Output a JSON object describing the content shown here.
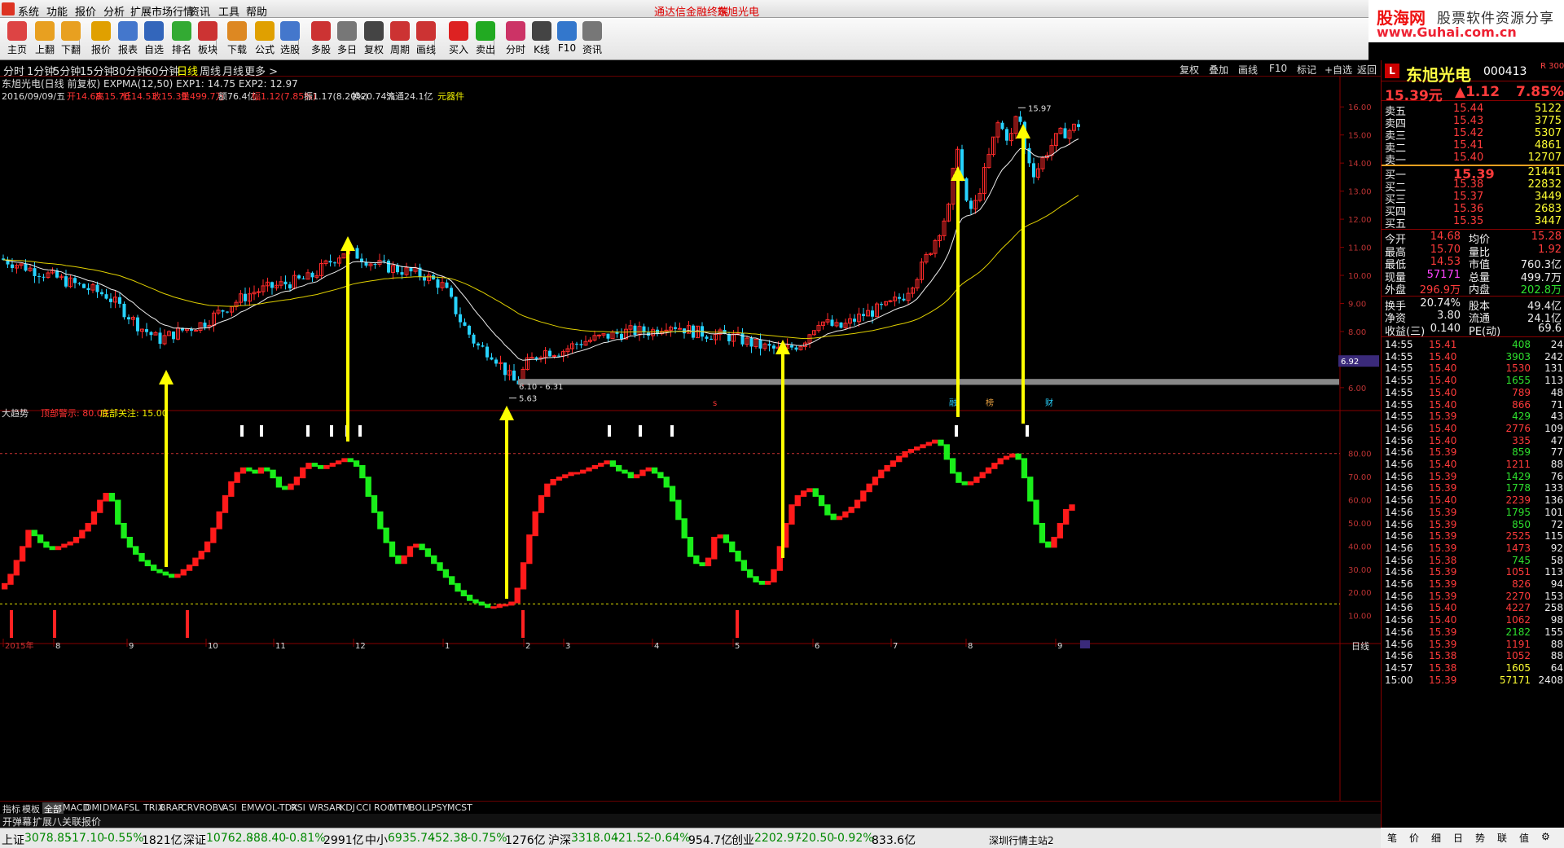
{
  "menubar": {
    "items": [
      "系统",
      "功能",
      "报价",
      "分析",
      "扩展市场行情",
      "资讯",
      "工具",
      "帮助"
    ],
    "center_title": "通达信金融终端",
    "center_stock": "东旭光电"
  },
  "brand": {
    "line1": "股海网",
    "line2": "股票软件资源分享",
    "line3": "www.Guhai.com.cn"
  },
  "toolbar": {
    "buttons": [
      {
        "label": "主页",
        "icon": "home-icon",
        "color": "#d44"
      },
      {
        "label": "上翻",
        "icon": "up-arrow-icon",
        "color": "#e8a020"
      },
      {
        "label": "下翻",
        "icon": "down-arrow-icon",
        "color": "#e8a020"
      },
      {
        "label": "报价",
        "icon": "yen-icon",
        "color": "#e0a000"
      },
      {
        "label": "报表",
        "icon": "report-icon",
        "color": "#4477cc"
      },
      {
        "label": "自选",
        "icon": "f6-icon",
        "color": "#3366bb"
      },
      {
        "label": "排名",
        "icon": "rank-icon",
        "color": "#33aa33"
      },
      {
        "label": "板块",
        "icon": "blocks-icon",
        "color": "#cc3333"
      },
      {
        "label": "下载",
        "icon": "download-icon",
        "color": "#dd8822"
      },
      {
        "label": "公式",
        "icon": "formula-icon",
        "color": "#e0a000"
      },
      {
        "label": "选股",
        "icon": "select-icon",
        "color": "#4477cc"
      },
      {
        "label": "多股",
        "icon": "multi-icon",
        "color": "#cc3333"
      },
      {
        "label": "多日",
        "icon": "clock-icon",
        "color": "#777777"
      },
      {
        "label": "复权",
        "icon": "restore-icon",
        "color": "#444444"
      },
      {
        "label": "周期",
        "icon": "f8-icon",
        "color": "#cc3333"
      },
      {
        "label": "画线",
        "icon": "draw-icon",
        "color": "#cc3333"
      },
      {
        "label": "买入",
        "icon": "buy-icon",
        "color": "#dd2222"
      },
      {
        "label": "卖出",
        "icon": "sell-icon",
        "color": "#22aa22"
      },
      {
        "label": "分时",
        "icon": "timeshare-icon",
        "color": "#cc3366"
      },
      {
        "label": "K线",
        "icon": "kline-icon",
        "color": "#444444"
      },
      {
        "label": "F10",
        "icon": "f10-icon",
        "color": "#3377cc"
      },
      {
        "label": "资讯",
        "icon": "news-icon",
        "color": "#777777"
      }
    ]
  },
  "period_bar": {
    "items": [
      "分时",
      "1分钟",
      "5分钟",
      "15分钟",
      "30分钟",
      "60分钟",
      "日线",
      "周线",
      "月线",
      "更多 >"
    ],
    "active": "日线",
    "right_items": [
      "复权",
      "叠加",
      "画线",
      "F10",
      "标记",
      "+自选",
      "返回"
    ]
  },
  "chart_header": {
    "title": "东旭光电(日线 前复权) EXPMA(12,50) EXP1: 14.75 EXP2: 12.97",
    "date_info": "2016/09/09/五",
    "open": "开14.68",
    "high": "高15.70",
    "low": "低14.53",
    "close": "收15.39",
    "volume": "量499.7万",
    "amount": "额76.4亿",
    "change": "幅1.12(7.85%)",
    "amplitude": "振1.17(8.20%)",
    "turnover": "换20.74%",
    "float": "流通24.1亿",
    "sector": "元器件"
  },
  "indicator_header": {
    "name": "大趋势",
    "top_warning": "顶部警示: 80.00",
    "bottom_attention": "底部关注: 15.00"
  },
  "chart_data": [
    {
      "type": "candlestick",
      "title": "东旭光电(日线 前复权)",
      "y_ticks": [
        "16.00",
        "15.00",
        "14.00",
        "13.00",
        "12.00",
        "11.00",
        "10.00",
        "9.00",
        "8.00",
        "7.00",
        "6.00"
      ],
      "ylim": [
        5.3,
        16.5
      ],
      "x_month_labels": [
        "2015年",
        "8",
        "9",
        "10",
        "11",
        "12",
        "1",
        "2",
        "3",
        "4",
        "5",
        "6",
        "7",
        "8",
        "9"
      ],
      "annotations": [
        "15.97",
        "6.10 - 6.31",
        "5.63",
        "6.92"
      ],
      "support_band": {
        "low": 6.1,
        "high": 6.31
      },
      "event_markers": [
        "融",
        "榜",
        "财"
      ],
      "series": [
        {
          "name": "EXP1",
          "value": 14.75
        },
        {
          "name": "EXP2",
          "value": 12.97
        }
      ]
    },
    {
      "type": "line",
      "title": "大趋势",
      "y_ticks": [
        "80.00",
        "70.00",
        "60.00",
        "50.00",
        "40.00",
        "30.00",
        "20.00",
        "10.00"
      ],
      "ylim": [
        0,
        88
      ],
      "top_line": 80,
      "bottom_line": 15,
      "values": [
        22,
        24,
        28,
        34,
        40,
        47,
        45,
        42,
        40,
        39,
        40,
        41,
        42,
        44,
        47,
        50,
        55,
        60,
        63,
        60,
        50,
        44,
        40,
        37,
        34,
        32,
        30,
        29,
        28,
        27,
        28,
        30,
        32,
        35,
        38,
        42,
        48,
        55,
        62,
        68,
        72,
        74,
        73,
        72,
        74,
        73,
        70,
        66,
        65,
        67,
        70,
        74,
        76,
        75,
        74,
        75,
        76,
        77,
        78,
        77,
        75,
        70,
        62,
        55,
        48,
        42,
        36,
        33,
        36,
        40,
        41,
        39,
        36,
        33,
        30,
        27,
        24,
        21,
        19,
        17,
        16,
        15,
        14,
        14,
        15,
        15,
        16,
        22,
        33,
        45,
        55,
        62,
        67,
        69,
        70,
        71,
        72,
        72,
        73,
        74,
        75,
        76,
        77,
        75,
        73,
        72,
        70,
        71,
        73,
        74,
        72,
        70,
        66,
        60,
        52,
        44,
        36,
        33,
        32,
        35,
        44,
        45,
        42,
        38,
        34,
        30,
        27,
        25,
        24,
        25,
        30,
        40,
        50,
        58,
        62,
        64,
        65,
        62,
        58,
        54,
        52,
        53,
        55,
        57,
        60,
        64,
        67,
        70,
        73,
        75,
        77,
        79,
        81,
        82,
        83,
        84,
        85,
        86,
        84,
        78,
        72,
        68,
        67,
        68,
        70,
        72,
        74,
        76,
        78,
        79,
        80,
        78,
        70,
        60,
        50,
        42,
        40,
        44,
        50,
        56,
        58
      ],
      "bottom_signal_bars": [
        "2015-08 early",
        "2015-08",
        "2015-09",
        "2016-01-end",
        "2016-05"
      ],
      "top_signal_marks": 14
    }
  ],
  "right_panel": {
    "badge": "L",
    "name": "东旭光电",
    "code": "000413",
    "r_mark": "R 300",
    "price": "15.39元",
    "change": "▲1.12",
    "pct": "7.85%",
    "asks": [
      {
        "label": "卖五",
        "price": "15.44",
        "vol": "5122"
      },
      {
        "label": "卖四",
        "price": "15.43",
        "vol": "3775"
      },
      {
        "label": "卖三",
        "price": "15.42",
        "vol": "5307"
      },
      {
        "label": "卖二",
        "price": "15.41",
        "vol": "4861"
      },
      {
        "label": "卖一",
        "price": "15.40",
        "vol": "12707"
      }
    ],
    "bids": [
      {
        "label": "买一",
        "price": "15.39",
        "vol": "21441"
      },
      {
        "label": "买二",
        "price": "15.38",
        "vol": "22832"
      },
      {
        "label": "买三",
        "price": "15.37",
        "vol": "3449"
      },
      {
        "label": "买四",
        "price": "15.36",
        "vol": "2683"
      },
      {
        "label": "买五",
        "price": "15.35",
        "vol": "3447"
      }
    ],
    "stats": [
      {
        "l1": "今开",
        "v1": "14.68",
        "c1": "red",
        "l2": "均价",
        "v2": "15.28",
        "c2": "red"
      },
      {
        "l1": "最高",
        "v1": "15.70",
        "c1": "red",
        "l2": "量比",
        "v2": "1.92",
        "c2": "red"
      },
      {
        "l1": "最低",
        "v1": "14.53",
        "c1": "red",
        "l2": "市值",
        "v2": "760.3亿",
        "c2": "white"
      },
      {
        "l1": "现量",
        "v1": "57171",
        "c1": "magenta",
        "l2": "总量",
        "v2": "499.7万",
        "c2": "white"
      },
      {
        "l1": "外盘",
        "v1": "296.9万",
        "c1": "red",
        "l2": "内盘",
        "v2": "202.8万",
        "c2": "green"
      }
    ],
    "stats2": [
      {
        "l1": "换手",
        "v1": "20.74%",
        "l2": "股本",
        "v2": "49.4亿"
      },
      {
        "l1": "净资",
        "v1": "3.80",
        "l2": "流通",
        "v2": "24.1亿"
      },
      {
        "l1": "收益(三)",
        "v1": "0.140",
        "l2": "PE(动)",
        "v2": "69.6"
      }
    ],
    "ticks": [
      {
        "t": "14:55",
        "p": "15.41",
        "v": "408",
        "n": "24",
        "c": "green"
      },
      {
        "t": "14:55",
        "p": "15.40",
        "v": "3903",
        "n": "242",
        "c": "green"
      },
      {
        "t": "14:55",
        "p": "15.40",
        "v": "1530",
        "n": "131",
        "c": "red"
      },
      {
        "t": "14:55",
        "p": "15.40",
        "v": "1655",
        "n": "113",
        "c": "green"
      },
      {
        "t": "14:55",
        "p": "15.40",
        "v": "789",
        "n": "48",
        "c": "red"
      },
      {
        "t": "14:55",
        "p": "15.40",
        "v": "866",
        "n": "71",
        "c": "red"
      },
      {
        "t": "14:55",
        "p": "15.39",
        "v": "429",
        "n": "43",
        "c": "green"
      },
      {
        "t": "14:56",
        "p": "15.40",
        "v": "2776",
        "n": "109",
        "c": "red"
      },
      {
        "t": "14:56",
        "p": "15.40",
        "v": "335",
        "n": "47",
        "c": "red"
      },
      {
        "t": "14:56",
        "p": "15.39",
        "v": "859",
        "n": "77",
        "c": "green"
      },
      {
        "t": "14:56",
        "p": "15.40",
        "v": "1211",
        "n": "88",
        "c": "red"
      },
      {
        "t": "14:56",
        "p": "15.39",
        "v": "1429",
        "n": "76",
        "c": "green"
      },
      {
        "t": "14:56",
        "p": "15.39",
        "v": "1778",
        "n": "133",
        "c": "green"
      },
      {
        "t": "14:56",
        "p": "15.40",
        "v": "2239",
        "n": "136",
        "c": "red"
      },
      {
        "t": "14:56",
        "p": "15.39",
        "v": "1795",
        "n": "101",
        "c": "green"
      },
      {
        "t": "14:56",
        "p": "15.39",
        "v": "850",
        "n": "72",
        "c": "green"
      },
      {
        "t": "14:56",
        "p": "15.39",
        "v": "2525",
        "n": "115",
        "c": "red"
      },
      {
        "t": "14:56",
        "p": "15.39",
        "v": "1473",
        "n": "92",
        "c": "red"
      },
      {
        "t": "14:56",
        "p": "15.38",
        "v": "745",
        "n": "58",
        "c": "green"
      },
      {
        "t": "14:56",
        "p": "15.39",
        "v": "1051",
        "n": "113",
        "c": "red"
      },
      {
        "t": "14:56",
        "p": "15.39",
        "v": "826",
        "n": "94",
        "c": "red"
      },
      {
        "t": "14:56",
        "p": "15.39",
        "v": "2270",
        "n": "153",
        "c": "red"
      },
      {
        "t": "14:56",
        "p": "15.40",
        "v": "4227",
        "n": "258",
        "c": "red"
      },
      {
        "t": "14:56",
        "p": "15.40",
        "v": "1062",
        "n": "98",
        "c": "red"
      },
      {
        "t": "14:56",
        "p": "15.39",
        "v": "2182",
        "n": "155",
        "c": "green"
      },
      {
        "t": "14:56",
        "p": "15.39",
        "v": "1191",
        "n": "88",
        "c": "red"
      },
      {
        "t": "14:56",
        "p": "15.38",
        "v": "1052",
        "n": "88",
        "c": "red"
      },
      {
        "t": "14:57",
        "p": "15.38",
        "v": "1605",
        "n": "64",
        "c": "yellow"
      },
      {
        "t": "15:00",
        "p": "15.39",
        "v": "57171",
        "n": "2408",
        "c": "yellow"
      }
    ],
    "bottom_tabs": [
      "笔",
      "价",
      "细",
      "日",
      "势",
      "联",
      "值",
      "⚙"
    ]
  },
  "index_tabs": [
    "指标",
    "模板",
    "全部",
    "MACD",
    "DMI",
    "DMA",
    "FSL",
    "TRIX",
    "BRAR",
    "CR",
    "VR",
    "OBV",
    "ASI",
    "EMV",
    "VOL-TDX",
    "RSI",
    "WR",
    "SAR",
    "KDJ",
    "CCI",
    "ROC",
    "MTM",
    "BOLL",
    "PSY",
    "MCST"
  ],
  "index_tabs_active": "全部",
  "sub_tabs": [
    "开弹幕",
    "扩展八",
    "关联报价"
  ],
  "period_label": "日线",
  "statusbar": {
    "items": [
      {
        "label": "上证",
        "val": "3078.85",
        "chg": "-17.10",
        "pct": "-0.55%",
        "amt": "1821亿"
      },
      {
        "label": "深证",
        "val": "10762.8",
        "chg": "-88.40",
        "pct": "-0.81%",
        "amt": "2991亿"
      },
      {
        "label": "中小",
        "val": "6935.74",
        "chg": "-52.38",
        "pct": "-0.75%",
        "amt": "1276亿"
      },
      {
        "label": "沪深",
        "val": "3318.04",
        "chg": "-21.52",
        "pct": "-0.64%",
        "amt": "954.7亿"
      },
      {
        "label": "创业",
        "val": "2202.97",
        "chg": "-20.50",
        "pct": "-0.92%",
        "amt": "833.6亿"
      }
    ],
    "station": "深圳行情主站2"
  }
}
